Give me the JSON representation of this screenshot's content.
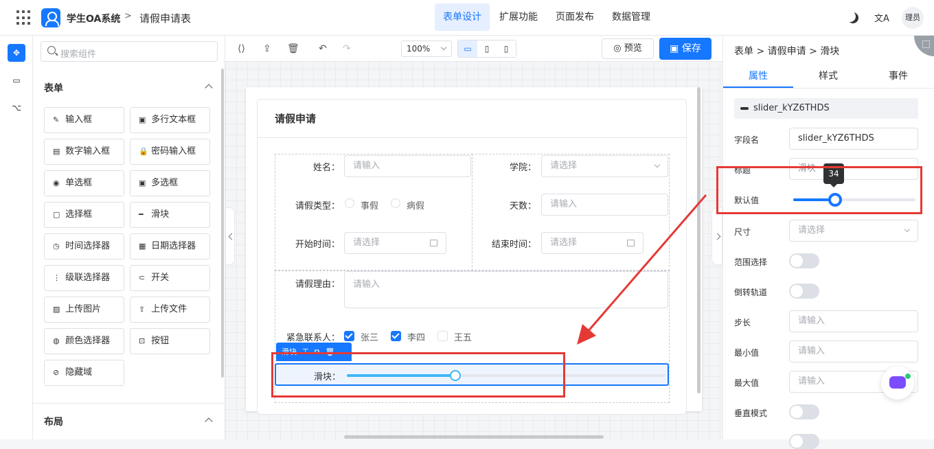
{
  "topbar": {
    "app_name": "学生OA系统",
    "separator": ">",
    "page_name": "请假申请表",
    "nav": [
      "表单设计",
      "扩展功能",
      "页面发布",
      "数据管理"
    ],
    "translate_icon": "文A",
    "user": "理员"
  },
  "palette": {
    "search_placeholder": "搜索组件",
    "section_form": "表单",
    "components": [
      {
        "icon": "✎",
        "label": "输入框"
      },
      {
        "icon": "▣",
        "label": "多行文本框"
      },
      {
        "icon": "▤",
        "label": "数字输入框"
      },
      {
        "icon": "🔒",
        "label": "密码输入框"
      },
      {
        "icon": "◉",
        "label": "单选框"
      },
      {
        "icon": "▣",
        "label": "多选框"
      },
      {
        "icon": "▢",
        "label": "选择框"
      },
      {
        "icon": "━",
        "label": "滑块"
      },
      {
        "icon": "◷",
        "label": "时间选择器"
      },
      {
        "icon": "▦",
        "label": "日期选择器"
      },
      {
        "icon": "⋮",
        "label": "级联选择器"
      },
      {
        "icon": "⊂",
        "label": "开关"
      },
      {
        "icon": "▨",
        "label": "上传图片"
      },
      {
        "icon": "⇪",
        "label": "上传文件"
      },
      {
        "icon": "◍",
        "label": "颜色选择器"
      },
      {
        "icon": "⊡",
        "label": "按钮"
      },
      {
        "icon": "⊘",
        "label": "隐藏域"
      }
    ],
    "section_layout": "布局"
  },
  "canvas_toolbar": {
    "zoom": "100%",
    "preview": "预览",
    "save": "保存"
  },
  "form": {
    "title": "请假申请",
    "name_label": "姓名：",
    "name_placeholder": "请输入",
    "college_label": "学院：",
    "college_placeholder": "请选择",
    "leave_type_label": "请假类型：",
    "leave_type_options": [
      "事假",
      "病假"
    ],
    "days_label": "天数：",
    "days_placeholder": "请输入",
    "start_label": "开始时间：",
    "start_placeholder": "请选择",
    "end_label": "结束时间：",
    "end_placeholder": "请选择",
    "reason_label": "请假理由：",
    "reason_placeholder": "请输入",
    "contact_label": "紧急联系人：",
    "contacts": [
      {
        "name": "张三",
        "checked": true
      },
      {
        "name": "李四",
        "checked": true
      },
      {
        "name": "王五",
        "checked": false
      }
    ],
    "selected_tag": "滑块",
    "slider_label": "滑块：",
    "slider_value": 34
  },
  "props": {
    "breadcrumb": "表单 > 请假申请 > 滑块",
    "tabs": [
      "属性",
      "样式",
      "事件"
    ],
    "component_id": "slider_kYZ6THDS",
    "field_name_label": "字段名",
    "field_name_value": "slider_kYZ6THDS",
    "title_label": "标题",
    "title_value": "滑块",
    "default_label": "默认值",
    "default_value": "34",
    "size_label": "尺寸",
    "size_placeholder": "请选择",
    "range_label": "范围选择",
    "reverse_label": "倒转轨道",
    "step_label": "步长",
    "step_placeholder": "请输入",
    "min_label": "最小值",
    "min_placeholder": "请输入",
    "max_label": "最大值",
    "max_placeholder": "请输入",
    "vertical_label": "垂直模式"
  },
  "colors": {
    "accent": "#1677ff",
    "slider": "#40b6f5",
    "annotation": "#e53935"
  }
}
